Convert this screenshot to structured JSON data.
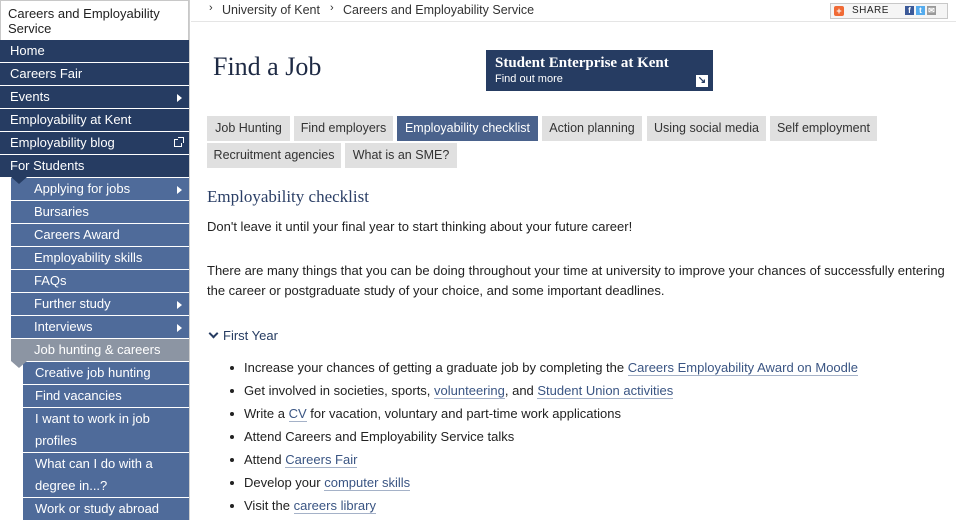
{
  "sidebar": {
    "site_title": "Careers and Employability Service",
    "items": [
      {
        "label": "Home"
      },
      {
        "label": "Careers Fair"
      },
      {
        "label": "Events"
      },
      {
        "label": "Employability at Kent"
      },
      {
        "label": "Employability blog"
      },
      {
        "label": "For Students"
      },
      {
        "label": "Applying for jobs"
      },
      {
        "label": "Bursaries"
      },
      {
        "label": "Careers Award"
      },
      {
        "label": "Employability skills"
      },
      {
        "label": "FAQs"
      },
      {
        "label": "Further study"
      },
      {
        "label": "Interviews"
      },
      {
        "label": "Job hunting & careers"
      },
      {
        "label": "Creative job hunting"
      },
      {
        "label": "Find vacancies"
      },
      {
        "label": "I want to work in job profiles"
      },
      {
        "label": "What can I do with a degree in...?"
      },
      {
        "label": "Work or study abroad"
      }
    ]
  },
  "breadcrumb": {
    "items": [
      "University of Kent",
      "Careers and Employability Service"
    ]
  },
  "share": {
    "label": "SHARE"
  },
  "header": {
    "title": "Find a Job"
  },
  "promo": {
    "title": "Student Enterprise at Kent",
    "subtitle": "Find out more"
  },
  "tabs": [
    {
      "label": "Job Hunting"
    },
    {
      "label": "Find employers"
    },
    {
      "label": "Employability checklist"
    },
    {
      "label": "Action planning"
    },
    {
      "label": "Using social media"
    },
    {
      "label": "Self employment"
    },
    {
      "label": "Recruitment agencies"
    },
    {
      "label": "What is an SME?"
    }
  ],
  "content": {
    "heading": "Employability checklist",
    "intro": "Don't leave it until your final year to start thinking about your future career!",
    "para": "There are many things that you can be doing throughout your time at university to improve your chances of successfully entering the career or postgraduate study of your choice, and some important deadlines.",
    "section_label": "First Year",
    "bullets": [
      {
        "pre": "Increase your chances of getting a graduate job by completing the ",
        "link": "Careers Employability Award on Moodle"
      },
      {
        "pre": "Get involved in societies, sports, ",
        "link": "volunteering",
        "mid": ", and ",
        "link2": "Student Union activities"
      },
      {
        "pre": "Write a ",
        "link": "CV",
        "post": " for vacation, voluntary and part-time work applications"
      },
      {
        "pre": "Attend Careers and Employability Service talks"
      },
      {
        "pre": "Attend ",
        "link": "Careers Fair"
      },
      {
        "pre": "Develop your ",
        "link": "computer skills"
      },
      {
        "pre": "Visit the ",
        "link": "careers library"
      }
    ]
  },
  "colors": {
    "navy": "#263c62",
    "sub_nav": "#4f6b9a",
    "active_tab": "#4a628c"
  }
}
